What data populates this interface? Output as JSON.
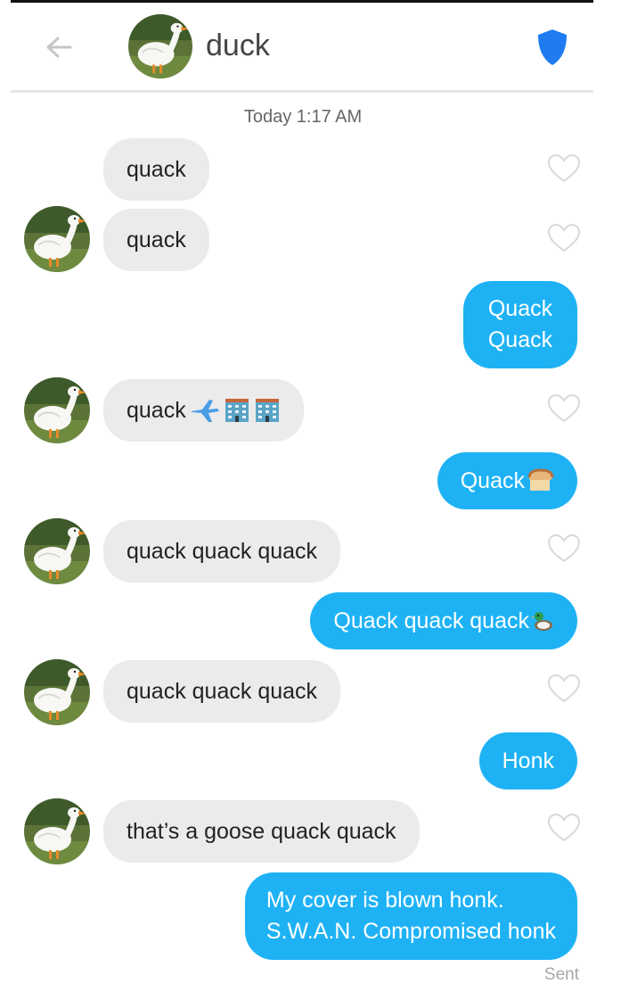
{
  "header": {
    "back_icon": "arrow-left-icon",
    "contact_name": "duck",
    "shield_icon": "shield-icon",
    "shield_color": "#1f7bf2"
  },
  "conversation": {
    "timestamp": "Today 1:17 AM",
    "messages": [
      {
        "from": "them",
        "text": "quack"
      },
      {
        "from": "them",
        "text": "quack"
      },
      {
        "from": "me",
        "lines": [
          "Quack",
          "Quack"
        ]
      },
      {
        "from": "them",
        "text": "quack",
        "emoji": [
          "airplane-emoji",
          "office-building-emoji",
          "office-building-emoji"
        ]
      },
      {
        "from": "me",
        "text": "Quack",
        "emoji": [
          "bread-emoji"
        ]
      },
      {
        "from": "them",
        "text": "quack quack quack"
      },
      {
        "from": "me",
        "text": "Quack quack quack",
        "emoji": [
          "duck-emoji"
        ]
      },
      {
        "from": "them",
        "text": "quack quack quack"
      },
      {
        "from": "me",
        "text": "Honk"
      },
      {
        "from": "them",
        "text": "that’s a goose quack quack"
      },
      {
        "from": "me",
        "lines": [
          "My cover is blown honk.",
          "S.W.A.N. Compromised honk"
        ]
      }
    ],
    "status": "Sent"
  },
  "colors": {
    "incoming_bubble": "#ebebec",
    "outgoing_bubble": "#1eb2f5",
    "like_heart": "#d8d8d8"
  }
}
